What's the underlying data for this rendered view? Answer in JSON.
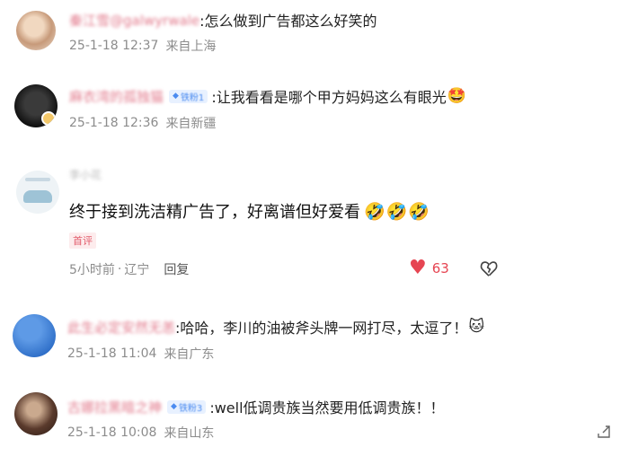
{
  "comments": [
    {
      "name": "秦江雪@galwyrwale",
      "text": ":怎么做到广告都这么好笑的",
      "date": "25-1-18 12:37",
      "location": "来自上海"
    },
    {
      "name": "麻衣湾的孤独猫",
      "badge": "铁粉1",
      "text": ":让我看看是哪个甲方妈妈这么有眼光",
      "emoji": "🤩",
      "date": "25-1-18 12:36",
      "location": "来自新疆"
    },
    {
      "name": "李小花",
      "text": "终于接到洗洁精广告了，好离谱但好爱看",
      "emojis": [
        "🤣",
        "🤣",
        "🤣"
      ],
      "tag": "首评",
      "time": "5小时前",
      "location": "辽宁",
      "reply": "回复",
      "likes": "63"
    },
    {
      "name": "此生必定安然无恙",
      "text": ":哈哈，李川的油被斧头牌一网打尽，太逗了！",
      "emoji": "🐱",
      "date": "25-1-18 11:04",
      "location": "来自广东"
    },
    {
      "name": "古娜拉黑暗之神",
      "badge": "铁粉3",
      "text": ":well低调贵族当然要用低调贵族！！",
      "date": "25-1-18 10:08",
      "location": "来自山东"
    }
  ],
  "colors": {
    "username": "#e27a8c",
    "meta": "#8c8c8c",
    "like": "#e64552",
    "badge_bg": "#e8f1ff",
    "badge_fg": "#4b8bf0"
  },
  "icons": [
    "heart-icon",
    "broken-heart-icon",
    "share-corner-icon"
  ]
}
